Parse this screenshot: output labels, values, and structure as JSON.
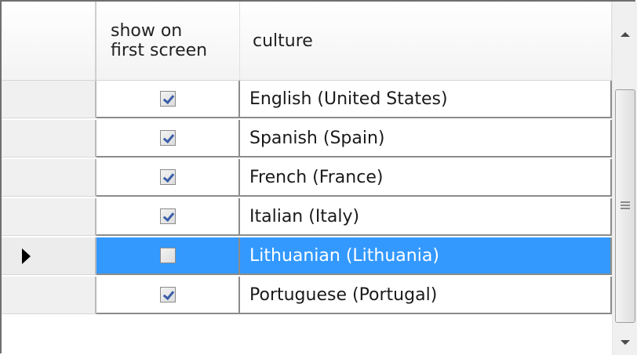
{
  "columns": {
    "show_line1": "show on",
    "show_line2": "first screen",
    "culture": "culture"
  },
  "rows": [
    {
      "checked": true,
      "culture": "English (United States)",
      "current": false,
      "selected": false
    },
    {
      "checked": true,
      "culture": "Spanish (Spain)",
      "current": false,
      "selected": false
    },
    {
      "checked": true,
      "culture": "French (France)",
      "current": false,
      "selected": false
    },
    {
      "checked": true,
      "culture": "Italian (Italy)",
      "current": false,
      "selected": false
    },
    {
      "checked": false,
      "culture": "Lithuanian (Lithuania)",
      "current": true,
      "selected": true
    },
    {
      "checked": true,
      "culture": "Portuguese (Portugal)",
      "current": false,
      "selected": false
    }
  ],
  "colors": {
    "selection": "#3399ff",
    "check": "#3b5ea9"
  },
  "icons": {
    "current_row": "row-pointer-arrow-icon",
    "scroll_up": "scroll-up-arrow-icon",
    "scroll_down": "scroll-down-arrow-icon",
    "grip": "scroll-grip-icon"
  }
}
